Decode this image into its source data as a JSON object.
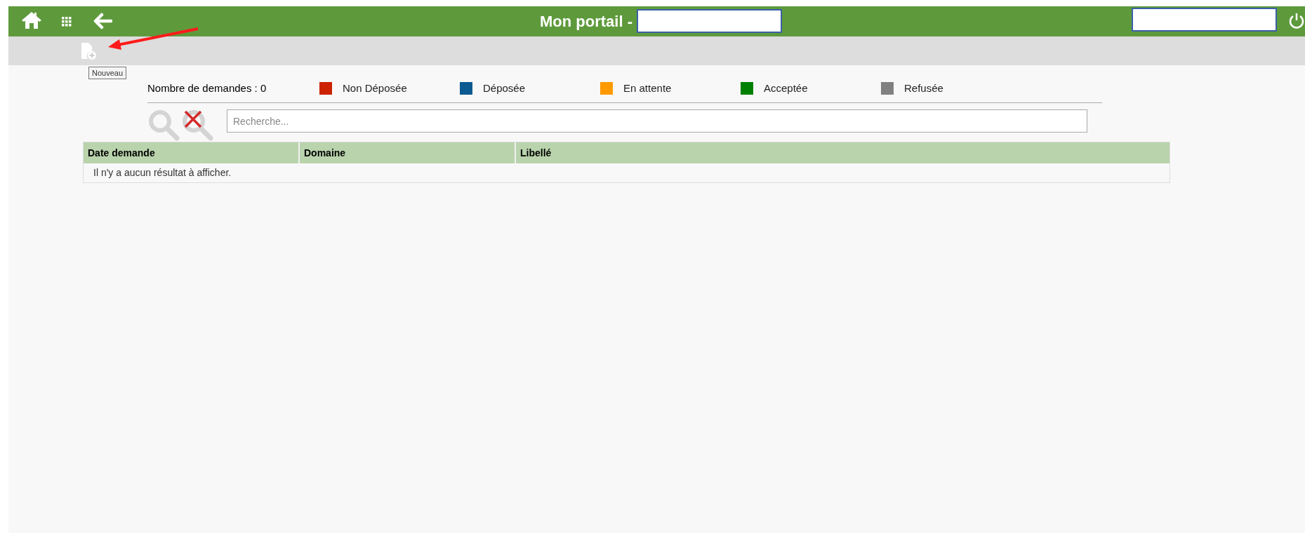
{
  "header": {
    "title": "Mon portail -"
  },
  "toolbar": {
    "tooltip": "Nouveau"
  },
  "summary": {
    "count_label": "Nombre de demandes : 0"
  },
  "legend": [
    {
      "label": "Non Déposée",
      "color": "#cc2200"
    },
    {
      "label": "Déposée",
      "color": "#0b5a91"
    },
    {
      "label": "En attente",
      "color": "#ff9900"
    },
    {
      "label": "Acceptée",
      "color": "#008000"
    },
    {
      "label": "Refusée",
      "color": "#808080"
    }
  ],
  "search": {
    "placeholder": "Recherche..."
  },
  "table": {
    "columns": [
      "Date demande",
      "Domaine",
      "Libellé"
    ],
    "empty_message": "Il n'y a aucun résultat à afficher."
  }
}
